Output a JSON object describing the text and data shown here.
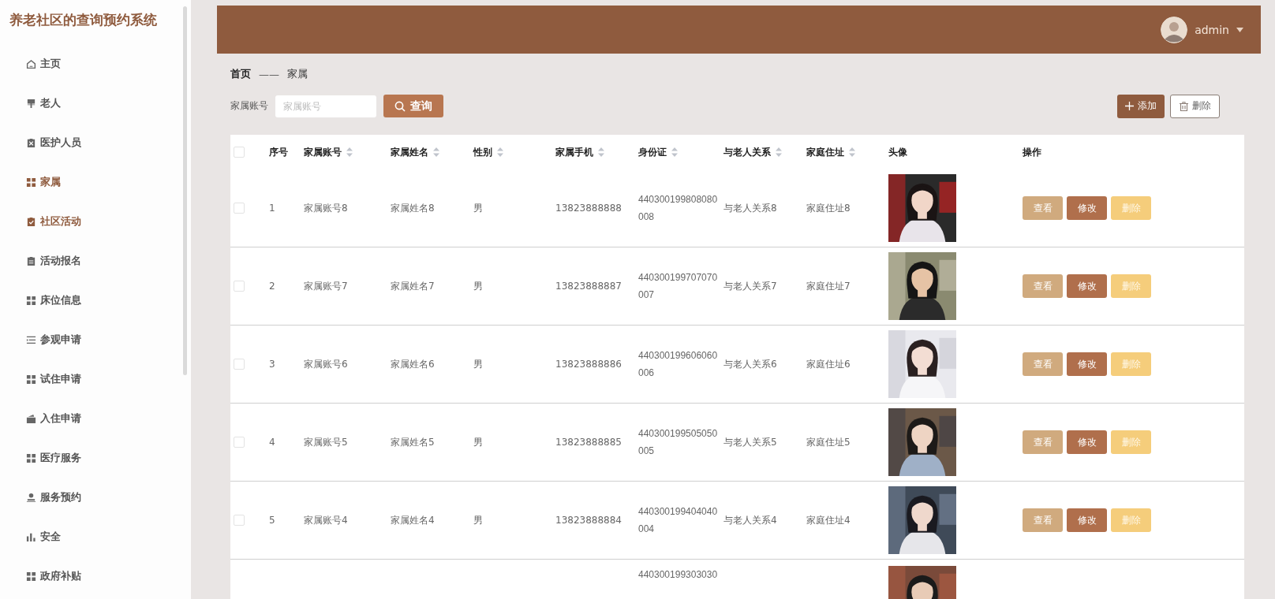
{
  "sidebar": {
    "title": "养老社区的查询预约系统",
    "items": [
      {
        "label": "主页",
        "selected": false
      },
      {
        "label": "老人",
        "selected": false
      },
      {
        "label": "医护人员",
        "selected": false
      },
      {
        "label": "家属",
        "selected": true
      },
      {
        "label": "社区活动",
        "selected": true
      },
      {
        "label": "活动报名",
        "selected": false
      },
      {
        "label": "床位信息",
        "selected": false
      },
      {
        "label": "参观申请",
        "selected": false
      },
      {
        "label": "试住申请",
        "selected": false
      },
      {
        "label": "入住申请",
        "selected": false
      },
      {
        "label": "医疗服务",
        "selected": false
      },
      {
        "label": "服务预约",
        "selected": false
      },
      {
        "label": "安全",
        "selected": false
      },
      {
        "label": "政府补贴",
        "selected": false
      }
    ]
  },
  "header": {
    "user": "admin"
  },
  "breadcrumb": {
    "home": "首页",
    "separator": "——",
    "current": "家属"
  },
  "search": {
    "label": "家属账号",
    "placeholder": "家属账号",
    "button": "查询"
  },
  "actions": {
    "add": "添加",
    "delete": "删除"
  },
  "table": {
    "all_checked": false,
    "columns": [
      {
        "label": "序号",
        "sortable": false
      },
      {
        "label": "家属账号",
        "sortable": true
      },
      {
        "label": "家属姓名",
        "sortable": true
      },
      {
        "label": "性别",
        "sortable": true
      },
      {
        "label": "家属手机",
        "sortable": true
      },
      {
        "label": "身份证",
        "sortable": true
      },
      {
        "label": "与老人关系",
        "sortable": true
      },
      {
        "label": "家庭住址",
        "sortable": true
      },
      {
        "label": "头像",
        "sortable": false
      },
      {
        "label": "操作",
        "sortable": false
      }
    ],
    "rows": [
      {
        "checked": false,
        "no": "1",
        "account": "家属账号8",
        "name": "家属姓名8",
        "gender": "男",
        "phone": "13823888888",
        "id_card": "440300199808080008",
        "relation": "与老人关系8",
        "address": "家庭住址8",
        "buttons": [
          "查看",
          "修改",
          "删除"
        ]
      },
      {
        "checked": false,
        "no": "2",
        "account": "家属账号7",
        "name": "家属姓名7",
        "gender": "男",
        "phone": "13823888887",
        "id_card": "440300199707070007",
        "relation": "与老人关系7",
        "address": "家庭住址7",
        "buttons": [
          "查看",
          "修改",
          "删除"
        ]
      },
      {
        "checked": false,
        "no": "3",
        "account": "家属账号6",
        "name": "家属姓名6",
        "gender": "男",
        "phone": "13823888886",
        "id_card": "440300199606060006",
        "relation": "与老人关系6",
        "address": "家庭住址6",
        "buttons": [
          "查看",
          "修改",
          "删除"
        ]
      },
      {
        "checked": false,
        "no": "4",
        "account": "家属账号5",
        "name": "家属姓名5",
        "gender": "男",
        "phone": "13823888885",
        "id_card": "440300199505050005",
        "relation": "与老人关系5",
        "address": "家庭住址5",
        "buttons": [
          "查看",
          "修改",
          "删除"
        ]
      },
      {
        "checked": false,
        "no": "5",
        "account": "家属账号4",
        "name": "家属姓名4",
        "gender": "男",
        "phone": "13823888884",
        "id_card": "440300199404040004",
        "relation": "与老人关系4",
        "address": "家庭住址4",
        "buttons": [
          "查看",
          "修改",
          "删除"
        ]
      }
    ],
    "partial_row": {
      "id_card": "440300199303030"
    }
  }
}
